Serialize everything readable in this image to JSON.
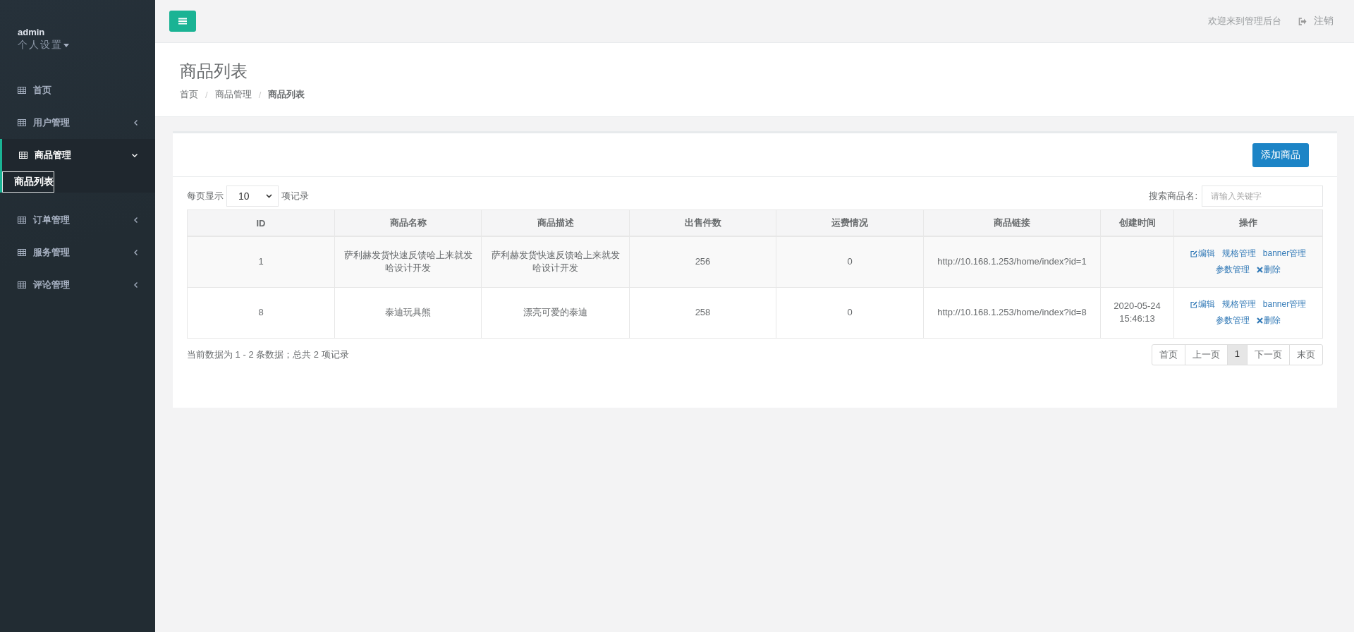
{
  "sidebar": {
    "user": {
      "name": "admin",
      "settings": "个人设置"
    },
    "items": [
      {
        "label": "首页"
      },
      {
        "label": "用户管理",
        "expanded": false
      },
      {
        "label": "商品管理",
        "expanded": true,
        "children": [
          {
            "label": "商品列表",
            "selected": true
          }
        ]
      },
      {
        "label": "订单管理",
        "expanded": false
      },
      {
        "label": "服务管理",
        "expanded": false
      },
      {
        "label": "评论管理",
        "expanded": false
      }
    ]
  },
  "topbar": {
    "welcome": "欢迎来到管理后台",
    "logout": "注销"
  },
  "page": {
    "title": "商品列表",
    "breadcrumb": [
      "首页",
      "商品管理",
      "商品列表"
    ],
    "breadcrumb_separator": "/"
  },
  "toolbar": {
    "add_button": "添加商品",
    "page_size_label": "每页显示",
    "page_size": "10",
    "page_size_suffix": "项记录",
    "search_label": "搜索商品名:",
    "search_placeholder": "请输入关键字"
  },
  "table": {
    "columns": [
      "ID",
      "商品名称",
      "商品描述",
      "出售件数",
      "运费情况",
      "商品链接",
      "创建时间",
      "操作"
    ],
    "rows": [
      {
        "cells": [
          "1",
          "萨利赫发货快速反馈哈上来就发哈设计开发",
          "萨利赫发货快速反馈哈上来就发哈设计开发",
          "256",
          "0",
          "http://10.168.1.253/home/index?id=1",
          ""
        ],
        "actions": [
          {
            "label": "编辑",
            "kind": "edit"
          },
          {
            "label": "规格管理",
            "kind": "plain"
          },
          {
            "label": "banner管理",
            "kind": "plain"
          },
          {
            "label": "参数管理",
            "kind": "plain"
          },
          {
            "label": "删除",
            "kind": "remove"
          }
        ]
      },
      {
        "cells": [
          "8",
          "泰迪玩具熊",
          "漂亮可爱的泰迪",
          "258",
          "0",
          "http://10.168.1.253/home/index?id=8",
          "2020-05-24 15:46:13"
        ],
        "actions": [
          {
            "label": "编辑",
            "kind": "edit"
          },
          {
            "label": "规格管理",
            "kind": "plain"
          },
          {
            "label": "banner管理",
            "kind": "plain"
          },
          {
            "label": "参数管理",
            "kind": "plain"
          },
          {
            "label": "删除",
            "kind": "remove"
          }
        ]
      }
    ]
  },
  "footer": {
    "summary": "当前数据为 1 - 2 条数据；总共 2 项记录",
    "pagination": [
      {
        "label": "首页",
        "selected": false
      },
      {
        "label": "上一页",
        "selected": false
      },
      {
        "label": "1",
        "selected": true
      },
      {
        "label": "下一页",
        "selected": false
      },
      {
        "label": "末页",
        "selected": false
      }
    ]
  }
}
